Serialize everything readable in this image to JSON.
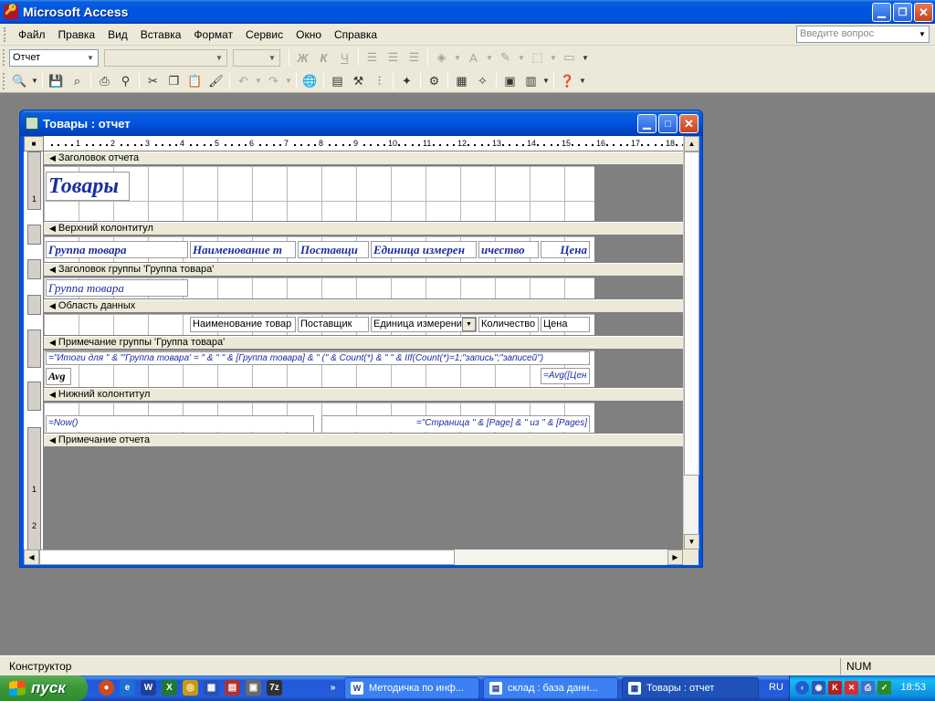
{
  "app": {
    "title": "Microsoft Access"
  },
  "menu": {
    "items": [
      "Файл",
      "Правка",
      "Вид",
      "Вставка",
      "Формат",
      "Сервис",
      "Окно",
      "Справка"
    ],
    "ask_placeholder": "Введите вопрос"
  },
  "toolbar1": {
    "object_combo": "Отчет"
  },
  "report_window": {
    "title": "Товары : отчет",
    "ruler_numbers": [
      "1",
      "2",
      "3",
      "4",
      "5",
      "6",
      "7",
      "8",
      "9",
      "10",
      "11",
      "12",
      "13",
      "14",
      "15",
      "16",
      "17",
      "18"
    ],
    "vruler_labels": [
      "1",
      "1",
      "2"
    ],
    "sections": {
      "report_header": "Заголовок отчета",
      "page_header": "Верхний колонтитул",
      "group_header": "Заголовок группы 'Группа товара'",
      "detail": "Область данных",
      "group_footer": "Примечание группы 'Группа товара'",
      "page_footer": "Нижний колонтитул",
      "report_footer": "Примечание отчета"
    },
    "controls": {
      "report_title": "Товары",
      "ph_group": "Группа товара",
      "ph_name": "Наименование т",
      "ph_supplier": "Поставщи",
      "ph_unit": "Единица измерен",
      "ph_qty": "ичество",
      "ph_price": "Цена",
      "gh_group": "Группа товара",
      "d_name": "Наименование товар",
      "d_supplier": "Поставщик",
      "d_unit": "Единица измерени",
      "d_qty": "Количество",
      "d_price": "Цена",
      "gf_expr": "=\"Итоги для \" & \"'Группа товара' = \" & \" \" & [Группа товара] & \" (\" & Count(*) & \" \" & IIf(Count(*)=1;\"запись\";\"записей\")",
      "gf_avg_label": "Avg",
      "gf_avg_expr": "=Avg([Цен",
      "pf_now": "=Now()",
      "pf_pages": "=\"Страница \" & [Page] & \" из \" & [Pages]"
    }
  },
  "status": {
    "mode": "Конструктор",
    "num": "NUM"
  },
  "taskbar": {
    "start": "пуск",
    "tasks": [
      "Методичка по инф...",
      "склад : база данн...",
      "Товары : отчет"
    ],
    "lang": "RU",
    "clock": "18:53"
  },
  "colors": {
    "titlebar": "#0054e3",
    "control_text": "#1b2da0",
    "face": "#ece9d8"
  }
}
